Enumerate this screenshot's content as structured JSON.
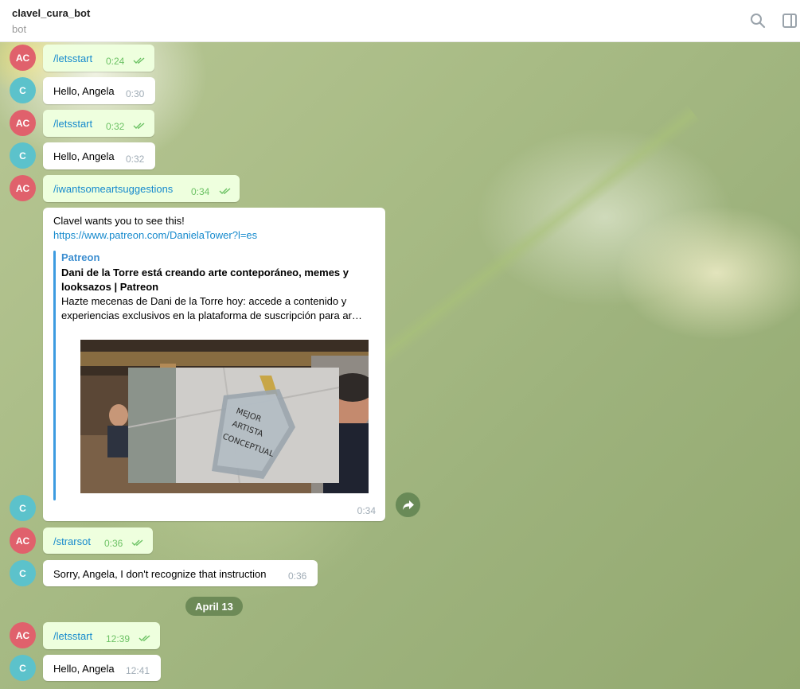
{
  "header": {
    "title": "clavel_cura_bot",
    "subtitle": "bot",
    "search_icon": "search-icon",
    "panel_icon": "panel-toggle-icon"
  },
  "avatars": {
    "user": "AC",
    "bot": "C"
  },
  "messages": [
    {
      "from": "user",
      "text": "/letsstart",
      "time": "0:24"
    },
    {
      "from": "bot",
      "text": "Hello, Angela",
      "time": "0:30"
    },
    {
      "from": "user",
      "text": "/letsstart",
      "time": "0:32"
    },
    {
      "from": "bot",
      "text": "Hello, Angela",
      "time": "0:32"
    },
    {
      "from": "user",
      "text": "/iwantsomeartsuggestions",
      "time": "0:34"
    },
    {
      "from": "user",
      "text": "/strarsot",
      "time": "0:36"
    },
    {
      "from": "bot",
      "text": "Sorry, Angela, I don't recognize that instruction",
      "time": "0:36"
    },
    {
      "from": "user",
      "text": "/letsstart",
      "time": "12:39"
    },
    {
      "from": "bot",
      "text": "Hello, Angela",
      "time": "12:41"
    }
  ],
  "link_card": {
    "text": "Clavel wants you to see this!",
    "url": "https://www.patreon.com/DanielaTower?l=es",
    "site": "Patreon",
    "title": "Dani de la Torre está creando arte conteporáneo, memes y looksazos | Patreon",
    "description_line1": "Hazte mecenas de Dani de la Torre hoy: accede a contenido y",
    "description_line2": "experiencias exclusivos en la plataforma de suscripción para ar…",
    "image_text": "MEJOR ARTISTA CONCEPTUAL",
    "time": "0:34"
  },
  "date_separator": "April 13",
  "colors": {
    "outgoing_bubble": "#eeffde",
    "incoming_bubble": "#ffffff",
    "link": "#168acd",
    "user_avatar": "#e0616c",
    "bot_avatar": "#5cc2cb"
  }
}
